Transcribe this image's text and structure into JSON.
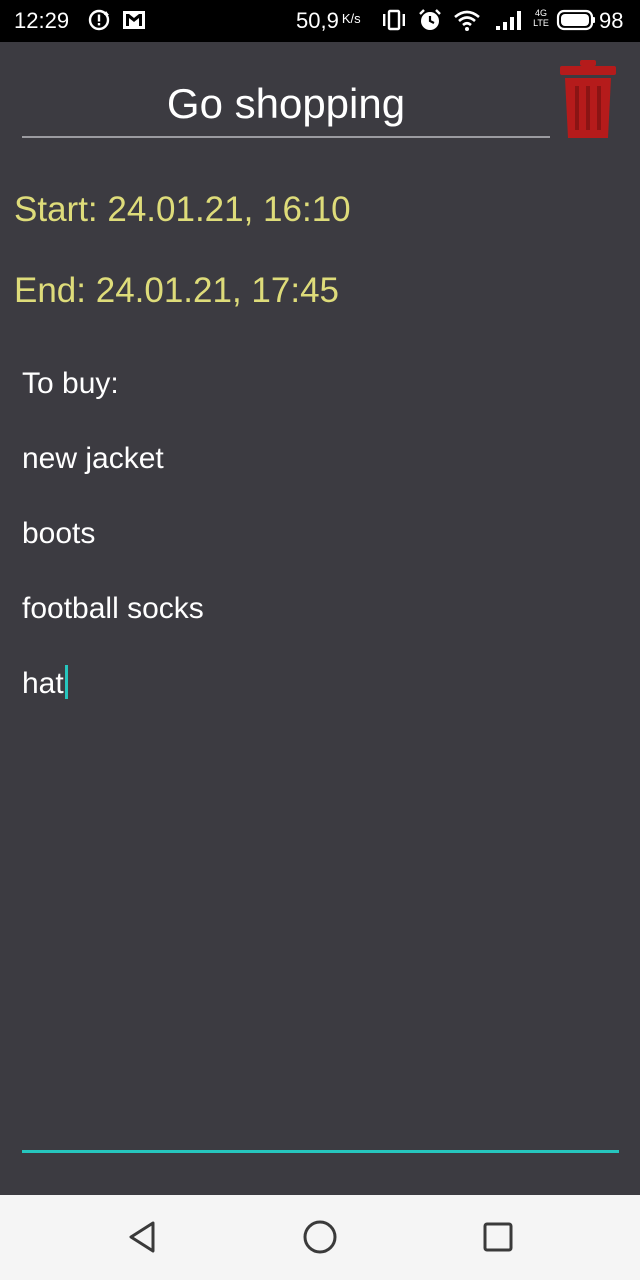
{
  "status_bar": {
    "time": "12:29",
    "speed": "50,9",
    "speed_unit": "K/s",
    "network": "4G LTE",
    "network_top": "4G",
    "network_bottom": "LTE",
    "battery": "98",
    "icons": [
      "sync-alert-icon",
      "gmail-icon",
      "vibrate-icon",
      "alarm-icon",
      "wifi-icon",
      "signal-icon",
      "battery-icon"
    ]
  },
  "note": {
    "title": "Go shopping",
    "start": "Start: 24.01.21, 16:10",
    "end": "End: 24.01.21, 17:45",
    "lines": [
      "To buy:",
      "new jacket",
      "boots",
      "football socks",
      "hat"
    ]
  },
  "actions": {
    "delete_icon": "trash-icon"
  },
  "nav_bar": {
    "buttons": [
      "back-icon",
      "home-icon",
      "recents-icon"
    ]
  },
  "colors": {
    "background": "#3c3b41",
    "date_text": "#dedc7a",
    "accent": "#26c6be",
    "delete": "#b51b1b",
    "nav_background": "#f5f5f5"
  }
}
